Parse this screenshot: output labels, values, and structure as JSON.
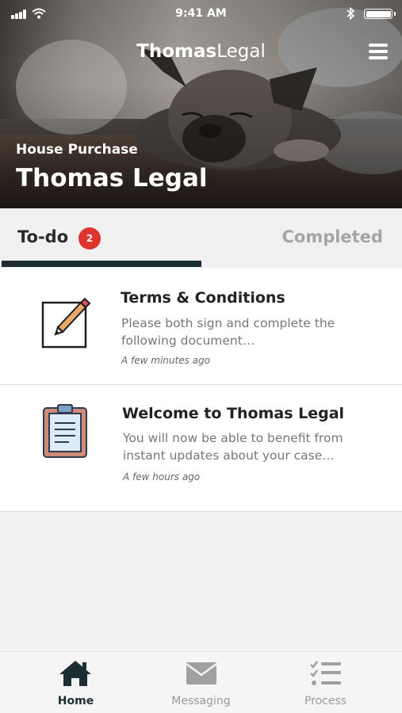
{
  "status_bar": {
    "time": "9:41 AM",
    "signal_icon": "signal-bars-icon",
    "wifi_icon": "wifi-icon",
    "bluetooth_icon": "bluetooth-icon",
    "battery_icon": "battery-icon"
  },
  "header": {
    "brand_bold": "Thomas",
    "brand_light": "Legal",
    "menu_icon": "hamburger-menu-icon",
    "subtitle": "House Purchase",
    "title": "Thomas Legal"
  },
  "tabs": [
    {
      "label": "To-do",
      "badge": "2",
      "active": true
    },
    {
      "label": "Completed",
      "active": false
    }
  ],
  "items": [
    {
      "icon": "pencil-document-icon",
      "title": "Terms & Conditions",
      "description": "Please both sign and complete the following document…",
      "time": "A few minutes ago"
    },
    {
      "icon": "clipboard-icon",
      "title": "Welcome to Thomas Legal",
      "description": "You will now be able to benefit from instant updates about your case…",
      "time": "A few hours ago"
    }
  ],
  "nav": [
    {
      "label": "Home",
      "icon": "home-icon",
      "active": true
    },
    {
      "label": "Messaging",
      "icon": "envelope-icon",
      "active": false
    },
    {
      "label": "Process",
      "icon": "checklist-icon",
      "active": false
    }
  ],
  "colors": {
    "accent": "#1c2d33",
    "badge": "#e0332e",
    "inactive": "#a5a5a5"
  }
}
